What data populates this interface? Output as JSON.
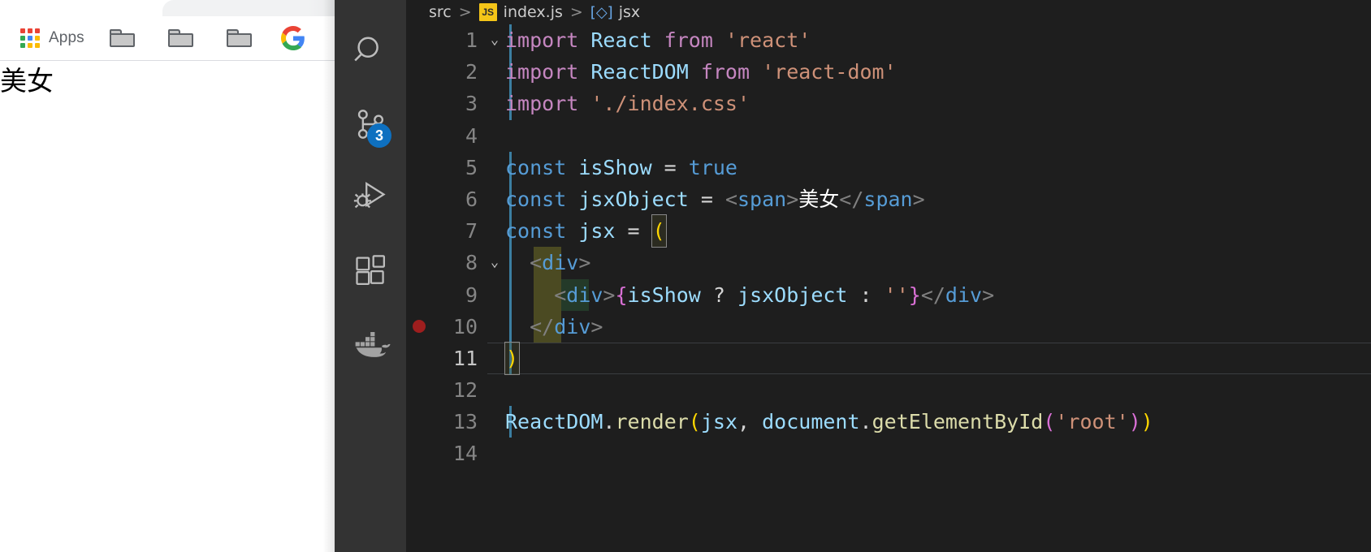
{
  "browser": {
    "bookmarks_bar": {
      "apps_icon": "apps-grid-icon",
      "apps_label": "Apps",
      "folders": [
        "folder-icon",
        "folder-icon",
        "folder-icon"
      ],
      "google_icon": "google-g-icon",
      "gmail_icon": "google-bookmark-icon"
    },
    "page_text": "美女"
  },
  "vscode": {
    "activity_bar": [
      {
        "name": "search-icon",
        "label": "Search"
      },
      {
        "name": "source-control-icon",
        "label": "Source Control",
        "badge": "3"
      },
      {
        "name": "run-and-debug-icon",
        "label": "Run and Debug"
      },
      {
        "name": "extensions-icon",
        "label": "Extensions"
      },
      {
        "name": "docker-icon",
        "label": "Docker"
      }
    ],
    "breadcrumb": {
      "root": "src",
      "separator": ">",
      "file_badge": "JS",
      "file": "index.js",
      "symbol_icon": "jsx-symbol-icon",
      "symbol": "jsx"
    },
    "editor": {
      "lines": [
        {
          "n": "1",
          "fold": "chevron-down-icon",
          "guide": "active",
          "breakpoint": false,
          "active": false,
          "tokens": [
            {
              "c": "t-kw",
              "t": "import "
            },
            {
              "c": "t-ident",
              "t": "React"
            },
            {
              "c": "t-kw",
              "t": " from "
            },
            {
              "c": "t-str",
              "t": "'react'"
            }
          ]
        },
        {
          "n": "2",
          "fold": "",
          "guide": "active",
          "breakpoint": false,
          "active": false,
          "tokens": [
            {
              "c": "t-kw",
              "t": "import "
            },
            {
              "c": "t-ident",
              "t": "ReactDOM"
            },
            {
              "c": "t-kw",
              "t": " from "
            },
            {
              "c": "t-str",
              "t": "'react-dom'"
            }
          ]
        },
        {
          "n": "3",
          "fold": "",
          "guide": "active",
          "breakpoint": false,
          "active": false,
          "tokens": [
            {
              "c": "t-kw",
              "t": "import "
            },
            {
              "c": "t-str",
              "t": "'./index.css'"
            }
          ]
        },
        {
          "n": "4",
          "fold": "",
          "guide": "",
          "breakpoint": false,
          "active": false,
          "tokens": []
        },
        {
          "n": "5",
          "fold": "",
          "guide": "active",
          "breakpoint": false,
          "active": false,
          "tokens": [
            {
              "c": "t-const",
              "t": "const "
            },
            {
              "c": "t-ident",
              "t": "isShow"
            },
            {
              "c": "t-op",
              "t": " = "
            },
            {
              "c": "t-const",
              "t": "true"
            }
          ]
        },
        {
          "n": "6",
          "fold": "",
          "guide": "active",
          "breakpoint": false,
          "active": false,
          "tokens": [
            {
              "c": "t-const",
              "t": "const "
            },
            {
              "c": "t-ident",
              "t": "jsxObject"
            },
            {
              "c": "t-op",
              "t": " = "
            },
            {
              "c": "t-punct",
              "t": "<"
            },
            {
              "c": "t-tag",
              "t": "span"
            },
            {
              "c": "t-punct",
              "t": ">"
            },
            {
              "c": "t-cn",
              "t": "美女"
            },
            {
              "c": "t-punct",
              "t": "</"
            },
            {
              "c": "t-tag",
              "t": "span"
            },
            {
              "c": "t-punct",
              "t": ">"
            }
          ]
        },
        {
          "n": "7",
          "fold": "",
          "guide": "active",
          "breakpoint": false,
          "active": false,
          "tokens": [
            {
              "c": "t-const",
              "t": "const "
            },
            {
              "c": "t-ident",
              "t": "jsx"
            },
            {
              "c": "t-op",
              "t": " = "
            },
            {
              "c": "t-brace-y bracket-match",
              "t": "("
            }
          ]
        },
        {
          "n": "8",
          "fold": "chevron-down-icon",
          "guide": "active",
          "indent": "olive",
          "breakpoint": false,
          "active": false,
          "tokens": [
            {
              "c": "t-punct",
              "t": "  <"
            },
            {
              "c": "t-tag",
              "t": "div"
            },
            {
              "c": "t-punct",
              "t": ">"
            }
          ]
        },
        {
          "n": "9",
          "fold": "",
          "guide": "active",
          "indent": "olive-green",
          "breakpoint": false,
          "active": false,
          "tokens": [
            {
              "c": "t-punct",
              "t": "    <"
            },
            {
              "c": "t-tag",
              "t": "div"
            },
            {
              "c": "t-punct",
              "t": ">"
            },
            {
              "c": "t-brace-m",
              "t": "{"
            },
            {
              "c": "t-ident",
              "t": "isShow"
            },
            {
              "c": "t-op",
              "t": " ? "
            },
            {
              "c": "t-ident",
              "t": "jsxObject"
            },
            {
              "c": "t-op",
              "t": " : "
            },
            {
              "c": "t-str",
              "t": "''"
            },
            {
              "c": "t-brace-m",
              "t": "}"
            },
            {
              "c": "t-punct",
              "t": "</"
            },
            {
              "c": "t-tag",
              "t": "div"
            },
            {
              "c": "t-punct",
              "t": ">"
            }
          ]
        },
        {
          "n": "10",
          "fold": "",
          "guide": "active",
          "indent": "olive",
          "breakpoint": true,
          "active": false,
          "tokens": [
            {
              "c": "t-punct",
              "t": "  </"
            },
            {
              "c": "t-tag",
              "t": "div"
            },
            {
              "c": "t-punct",
              "t": ">"
            }
          ]
        },
        {
          "n": "11",
          "fold": "",
          "guide": "active",
          "breakpoint": false,
          "active": true,
          "tokens": [
            {
              "c": "t-brace-y bracket-match",
              "t": ")"
            }
          ]
        },
        {
          "n": "12",
          "fold": "",
          "guide": "",
          "breakpoint": false,
          "active": false,
          "tokens": []
        },
        {
          "n": "13",
          "fold": "",
          "guide": "active",
          "breakpoint": false,
          "active": false,
          "tokens": [
            {
              "c": "t-ident",
              "t": "ReactDOM"
            },
            {
              "c": "t-plain",
              "t": "."
            },
            {
              "c": "t-fn",
              "t": "render"
            },
            {
              "c": "t-brace-y",
              "t": "("
            },
            {
              "c": "t-ident",
              "t": "jsx"
            },
            {
              "c": "t-plain",
              "t": ", "
            },
            {
              "c": "t-ident",
              "t": "document"
            },
            {
              "c": "t-plain",
              "t": "."
            },
            {
              "c": "t-fn",
              "t": "getElementById"
            },
            {
              "c": "t-brace-m",
              "t": "("
            },
            {
              "c": "t-str",
              "t": "'root'"
            },
            {
              "c": "t-brace-m",
              "t": ")"
            },
            {
              "c": "t-brace-y",
              "t": ")"
            }
          ]
        },
        {
          "n": "14",
          "fold": "",
          "guide": "",
          "breakpoint": false,
          "active": false,
          "tokens": []
        }
      ]
    }
  },
  "colors": {
    "editor_bg": "#1e1e1e",
    "activity_bar_bg": "#333333",
    "badge_bg": "#0e70c0",
    "breakpoint": "#9e1e1e",
    "indent_active": "#3b7ea1",
    "bracket_yellow": "#ffd700",
    "bracket_magenta": "#da70d6",
    "js_badge": "#f5c518"
  }
}
